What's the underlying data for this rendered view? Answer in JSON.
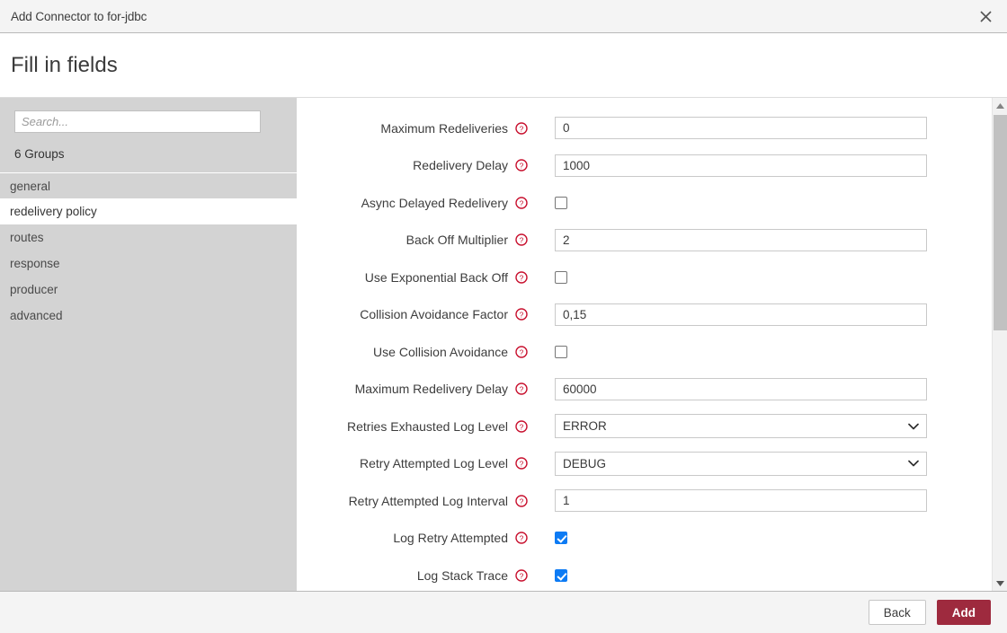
{
  "window": {
    "title": "Add Connector to for-jdbc",
    "close_icon": "close-icon"
  },
  "heading": {
    "title": "Fill in fields"
  },
  "sidebar": {
    "search": {
      "value": "",
      "placeholder": "Search..."
    },
    "groups_count_label": "6 Groups",
    "items": [
      {
        "label": "general",
        "selected": false
      },
      {
        "label": "redelivery policy",
        "selected": true
      },
      {
        "label": "routes",
        "selected": false
      },
      {
        "label": "response",
        "selected": false
      },
      {
        "label": "producer",
        "selected": false
      },
      {
        "label": "advanced",
        "selected": false
      }
    ]
  },
  "form": {
    "help_icon": "help-circle-icon",
    "fields": [
      {
        "label": "Maximum Redeliveries",
        "type": "text",
        "value": "0"
      },
      {
        "label": "Redelivery Delay",
        "type": "text",
        "value": "1000"
      },
      {
        "label": "Async Delayed Redelivery",
        "type": "checkbox",
        "checked": false
      },
      {
        "label": "Back Off Multiplier",
        "type": "text",
        "value": "2"
      },
      {
        "label": "Use Exponential Back Off",
        "type": "checkbox",
        "checked": false
      },
      {
        "label": "Collision Avoidance Factor",
        "type": "text",
        "value": "0,15"
      },
      {
        "label": "Use Collision Avoidance",
        "type": "checkbox",
        "checked": false
      },
      {
        "label": "Maximum Redelivery Delay",
        "type": "text",
        "value": "60000"
      },
      {
        "label": "Retries Exhausted Log Level",
        "type": "select",
        "value": "ERROR"
      },
      {
        "label": "Retry Attempted Log Level",
        "type": "select",
        "value": "DEBUG"
      },
      {
        "label": "Retry Attempted Log Interval",
        "type": "text",
        "value": "1"
      },
      {
        "label": "Log Retry Attempted",
        "type": "checkbox",
        "checked": true
      },
      {
        "label": "Log Stack Trace",
        "type": "checkbox",
        "checked": true
      }
    ]
  },
  "scrollbar": {
    "up_icon": "triangle-up-icon",
    "down_icon": "triangle-down-icon"
  },
  "footer": {
    "back_label": "Back",
    "add_label": "Add"
  },
  "colors": {
    "accent": "#9e2a3e",
    "help_icon": "#c8102e",
    "checkbox_checked": "#0d7bf4",
    "sidebar_bg": "#d3d3d3"
  }
}
